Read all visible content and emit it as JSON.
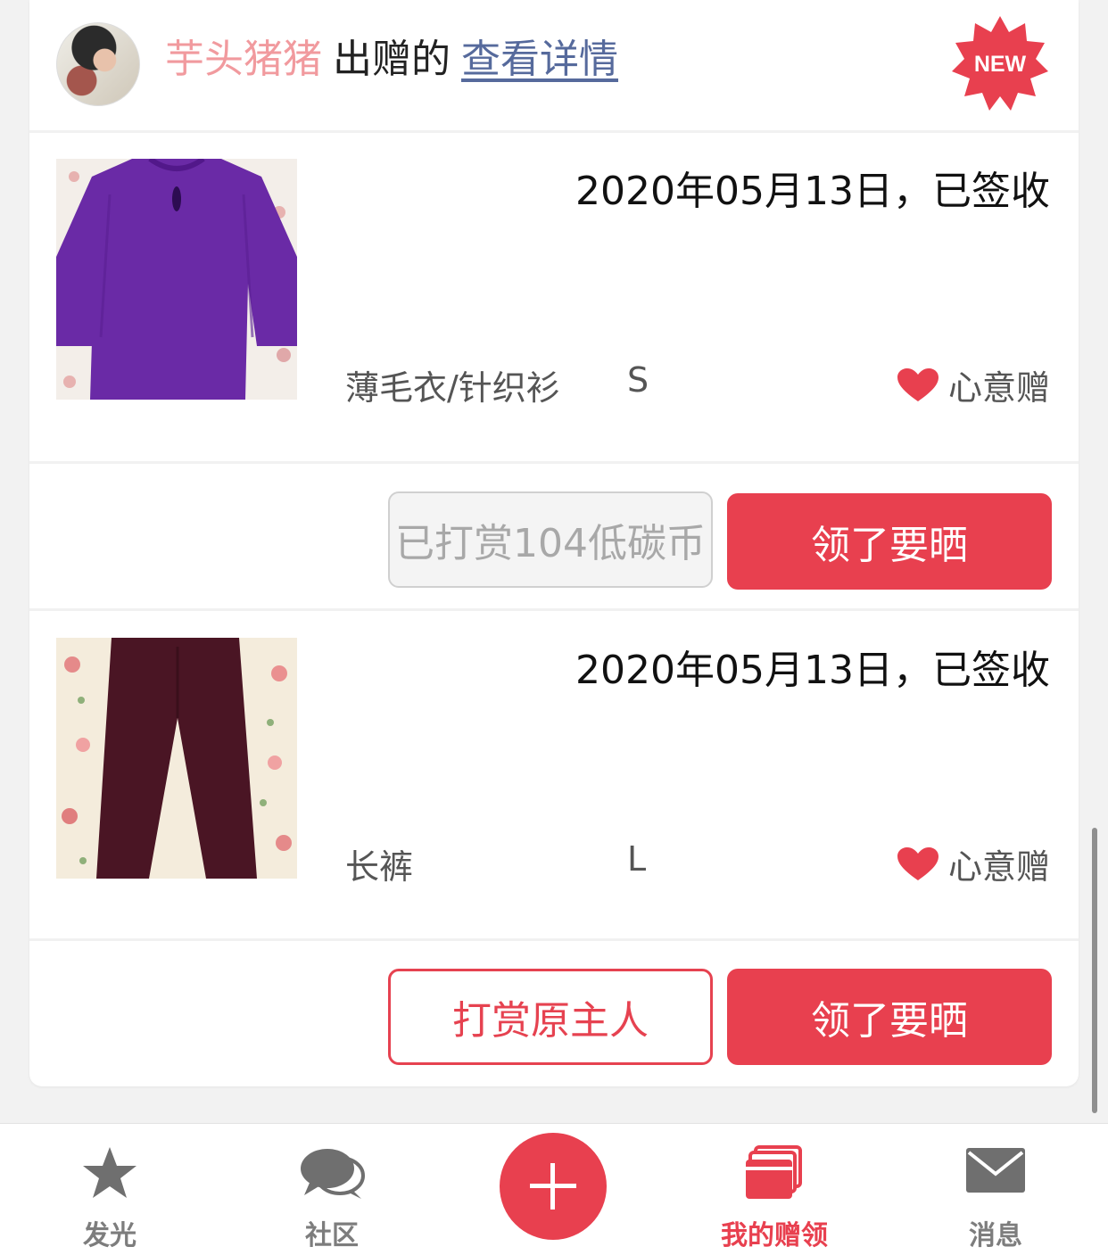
{
  "header": {
    "donor_name": "芋头猪猪",
    "action": "出赠的",
    "detail_link": "查看详情",
    "badge": "NEW"
  },
  "items": [
    {
      "date_status": "2020年05月13日，已签收",
      "category": "薄毛衣/针织衫",
      "size": "S",
      "gift_type": "心意赠",
      "photo": "purple-sweater",
      "secondary_button": "已打赏104低碳币",
      "primary_button": "领了要晒"
    },
    {
      "date_status": "2020年05月13日，已签收",
      "category": "长裤",
      "size": "L",
      "gift_type": "心意赠",
      "photo": "burgundy-pants",
      "secondary_button": "打赏原主人",
      "primary_button": "领了要晒"
    }
  ],
  "tabbar": {
    "tabs": [
      {
        "label": "发光",
        "icon": "star-icon"
      },
      {
        "label": "社区",
        "icon": "chat-bubbles-icon"
      },
      {
        "label": "",
        "icon": "plus-icon"
      },
      {
        "label": "我的赠领",
        "icon": "gift-box-icon",
        "active": true
      },
      {
        "label": "消息",
        "icon": "envelope-icon"
      }
    ]
  },
  "colors": {
    "accent": "#e8404f",
    "donor_pink": "#f19a9e",
    "link_blue": "#566a9c",
    "inactive_gray": "#7d7d7d"
  }
}
